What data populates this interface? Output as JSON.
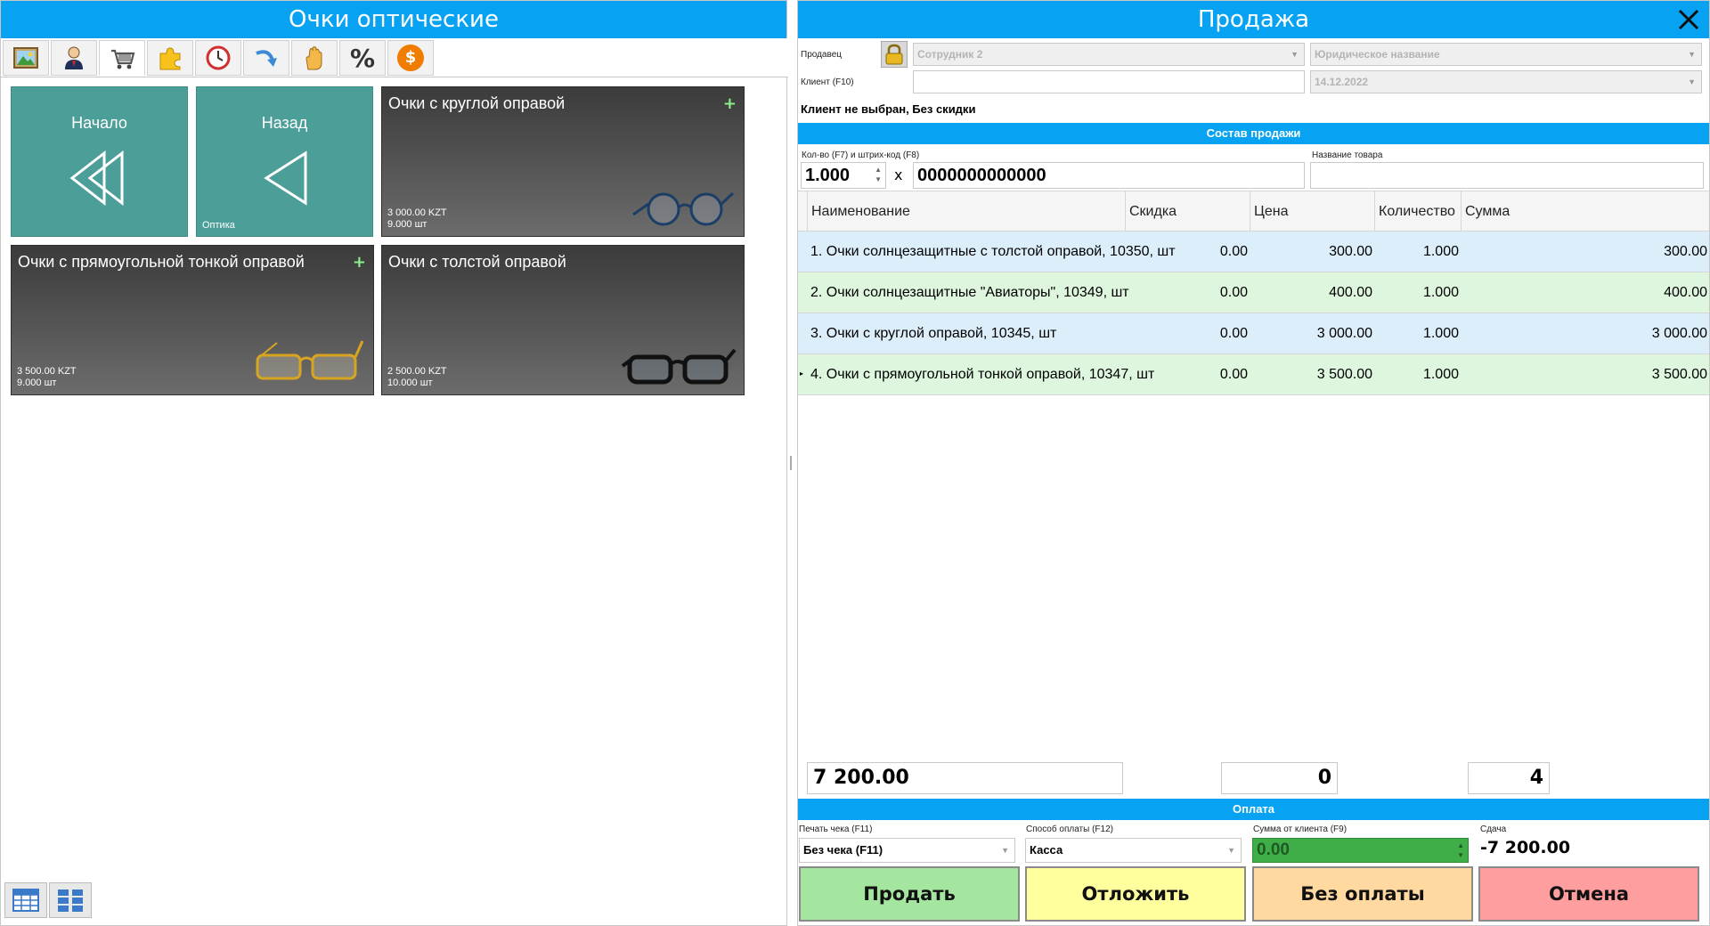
{
  "left_panel": {
    "title": "Очки оптические",
    "toolbar": [
      {
        "icon": "picture-icon"
      },
      {
        "icon": "user-icon"
      },
      {
        "icon": "cart-icon"
      },
      {
        "icon": "puzzle-icon"
      },
      {
        "icon": "clock-icon"
      },
      {
        "icon": "return-arrow-icon"
      },
      {
        "icon": "hand-icon"
      },
      {
        "icon": "percent-icon",
        "text": "%"
      },
      {
        "icon": "dollar-coin-icon",
        "text": "$"
      }
    ],
    "nav_tiles": {
      "start": {
        "label": "Начало"
      },
      "back": {
        "label": "Назад",
        "sub": "Оптика"
      }
    },
    "products": [
      {
        "name": "Очки с круглой оправой",
        "price": "3 000.00 KZT",
        "stock": "9.000 шт",
        "plus": "+",
        "glasses_color": "#1c3d66"
      },
      {
        "name": "Очки с прямоугольной тонкой оправой",
        "price": "3 500.00 KZT",
        "stock": "9.000 шт",
        "plus": "+",
        "glasses_color": "#d9a520"
      },
      {
        "name": "Очки с толстой оправой",
        "price": "2 500.00 KZT",
        "stock": "10.000 шт",
        "plus": "",
        "glasses_color": "#111111"
      }
    ]
  },
  "sale": {
    "title": "Продажа",
    "seller_label": "Продавец",
    "seller_value": "Сотрудник 2",
    "legal_name": "Юридическое название",
    "client_label": "Клиент (F10)",
    "client_value": "",
    "date": "14.12.2022",
    "client_status": "Клиент не выбран, Без скидки",
    "composition_title": "Состав продажи",
    "qty_label": "Кол-во (F7) и штрих-код (F8)",
    "qty_value": "1.000",
    "multiply": "x",
    "barcode_value": "0000000000000",
    "product_name_label": "Название товара",
    "product_name_value": "",
    "columns": {
      "name": "Наименование",
      "discount": "Скидка",
      "price": "Цена",
      "qty": "Количество",
      "sum": "Сумма"
    },
    "rows": [
      {
        "name": "1. Очки солнцезащитные с толстой оправой, 10350, шт",
        "discount": "0.00",
        "price": "300.00",
        "qty": "1.000",
        "sum": "300.00"
      },
      {
        "name": "2. Очки солнцезащитные \"Авиаторы\", 10349, шт",
        "discount": "0.00",
        "price": "400.00",
        "qty": "1.000",
        "sum": "400.00"
      },
      {
        "name": "3. Очки с круглой оправой, 10345, шт",
        "discount": "0.00",
        "price": "3 000.00",
        "qty": "1.000",
        "sum": "3 000.00"
      },
      {
        "name": "4. Очки с прямоугольной тонкой оправой, 10347, шт",
        "discount": "0.00",
        "price": "3 500.00",
        "qty": "1.000",
        "sum": "3 500.00"
      }
    ],
    "total_sum": "7 200.00",
    "total_discount": "0",
    "total_qty": "4",
    "payment_title": "Оплата",
    "print_label": "Печать чека (F11)",
    "print_value": "Без чека (F11)",
    "method_label": "Способ оплаты (F12)",
    "method_value": "Касса",
    "client_sum_label": "Сумма от клиента (F9)",
    "client_sum_value": "0.00",
    "change_label": "Сдача",
    "change_value": "-7 200.00",
    "buttons": {
      "sell": "Продать",
      "postpone": "Отложить",
      "no_payment": "Без оплаты",
      "cancel": "Отмена"
    },
    "colors": {
      "accent": "#07a3f2",
      "sell": "#a4e6a0",
      "postpone": "#ffff9e",
      "no_payment": "#ffd9a0",
      "cancel": "#ff9e9e",
      "client_sum_bg": "#3fae48",
      "row_a": "#dceefa",
      "row_b": "#ddf6dd"
    }
  }
}
